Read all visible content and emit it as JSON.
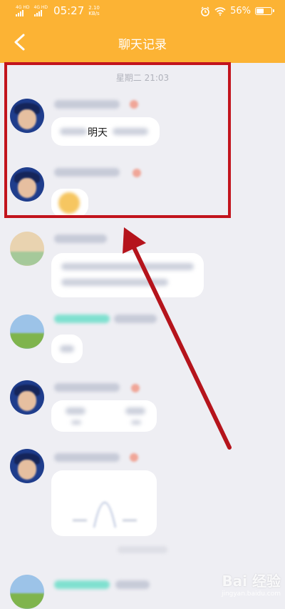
{
  "status_bar": {
    "sim1": "4G HD",
    "sim2": "4G HD",
    "time": "05:27",
    "speed_value": "2.10",
    "speed_unit": "KB/s",
    "battery": "56%",
    "battery_level": 0.56
  },
  "nav": {
    "title": "聊天记录",
    "back_icon": "chevron-left-icon"
  },
  "chat": {
    "timestamp": "星期二 21:03",
    "visible_text": "明天"
  },
  "watermark": {
    "text": "Bai 经验",
    "url": "jingyan.baidu.com"
  },
  "colors": {
    "header": "#fcb334",
    "highlight_box": "#c2141d",
    "arrow": "#b5141c"
  }
}
